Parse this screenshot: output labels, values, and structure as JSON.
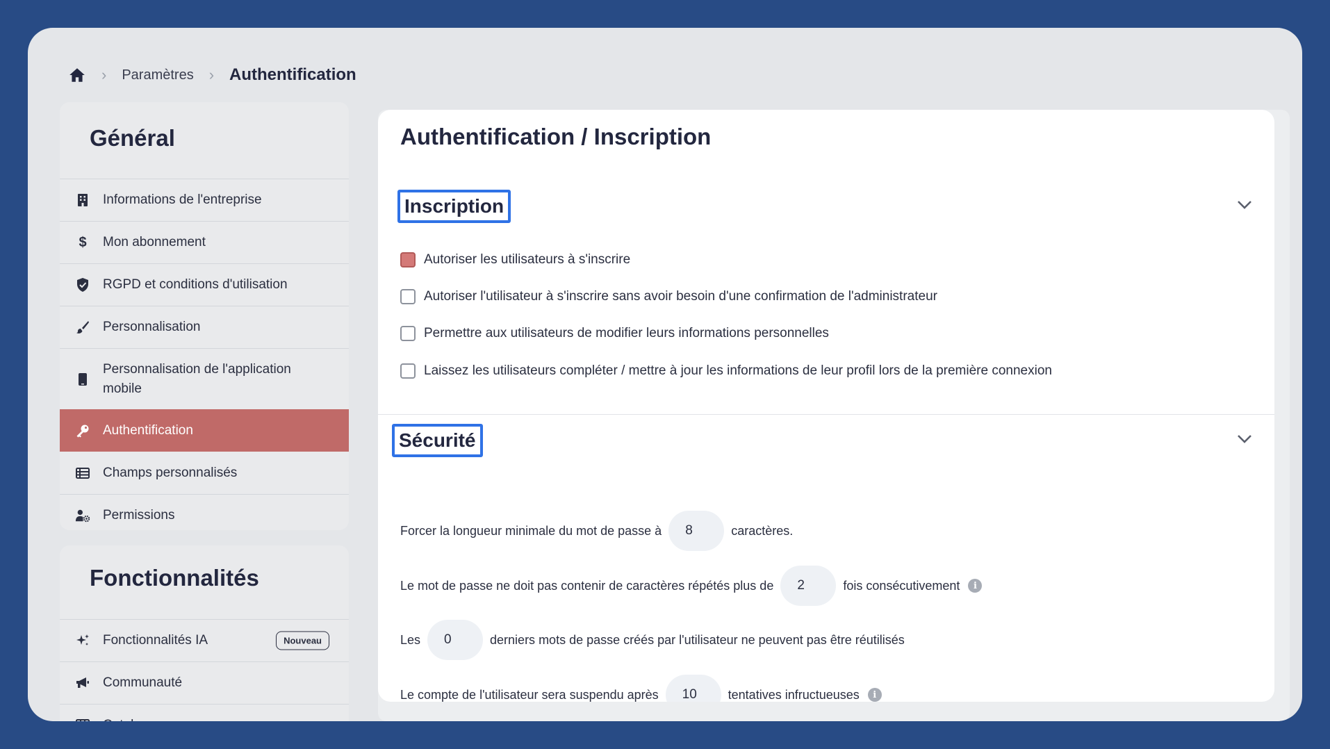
{
  "breadcrumb": {
    "items": [
      "Paramètres"
    ],
    "current": "Authentification",
    "separator": "›"
  },
  "sidebar": {
    "general": {
      "title": "Général",
      "items": [
        {
          "label": "Informations de l'entreprise",
          "icon": "building-icon"
        },
        {
          "label": "Mon abonnement",
          "icon": "dollar-icon"
        },
        {
          "label": "RGPD et conditions d'utilisation",
          "icon": "shield-icon"
        },
        {
          "label": "Personnalisation",
          "icon": "brush-icon"
        },
        {
          "label": "Personnalisation de l'application mobile",
          "icon": "mobile-icon"
        },
        {
          "label": "Authentification",
          "icon": "key-icon",
          "active": true
        },
        {
          "label": "Champs personnalisés",
          "icon": "table-icon"
        },
        {
          "label": "Permissions",
          "icon": "user-gear-icon"
        }
      ]
    },
    "features": {
      "title": "Fonctionnalités",
      "items": [
        {
          "label": "Fonctionnalités IA",
          "icon": "sparkles-icon",
          "badge": "Nouveau"
        },
        {
          "label": "Communauté",
          "icon": "megaphone-icon"
        },
        {
          "label": "Catalogues",
          "icon": "grid-icon"
        }
      ]
    }
  },
  "main": {
    "title": "Authentification / Inscription",
    "inscription": {
      "title": "Inscription",
      "options": [
        {
          "label": "Autoriser les utilisateurs à s'inscrire",
          "checked": true
        },
        {
          "label": "Autoriser l'utilisateur à s'inscrire sans avoir besoin d'une confirmation de l'administrateur",
          "checked": false
        },
        {
          "label": "Permettre aux utilisateurs de modifier leurs informations personnelles",
          "checked": false
        },
        {
          "label": "Laissez les utilisateurs compléter / mettre à jour les informations de leur profil lors de la première connexion",
          "checked": false
        }
      ]
    },
    "security": {
      "title": "Sécurité",
      "rows": [
        {
          "before": "Forcer la longueur minimale du mot de passe à",
          "value": "8",
          "after": "caractères.",
          "info": false
        },
        {
          "before": "Le mot de passe ne doit pas contenir de caractères répétés plus de",
          "value": "2",
          "after": "fois consécutivement",
          "info": true
        },
        {
          "before": "Les",
          "value": "0",
          "after": "derniers mots de passe créés par l'utilisateur ne peuvent pas être réutilisés",
          "info": false
        },
        {
          "before": "Le compte de l'utilisateur sera suspendu après",
          "value": "10",
          "after": "tentatives infructueuses",
          "info": true
        }
      ]
    }
  },
  "colors": {
    "background": "#284b85",
    "accent": "#c06a68",
    "highlight_border": "#2f72e6"
  }
}
